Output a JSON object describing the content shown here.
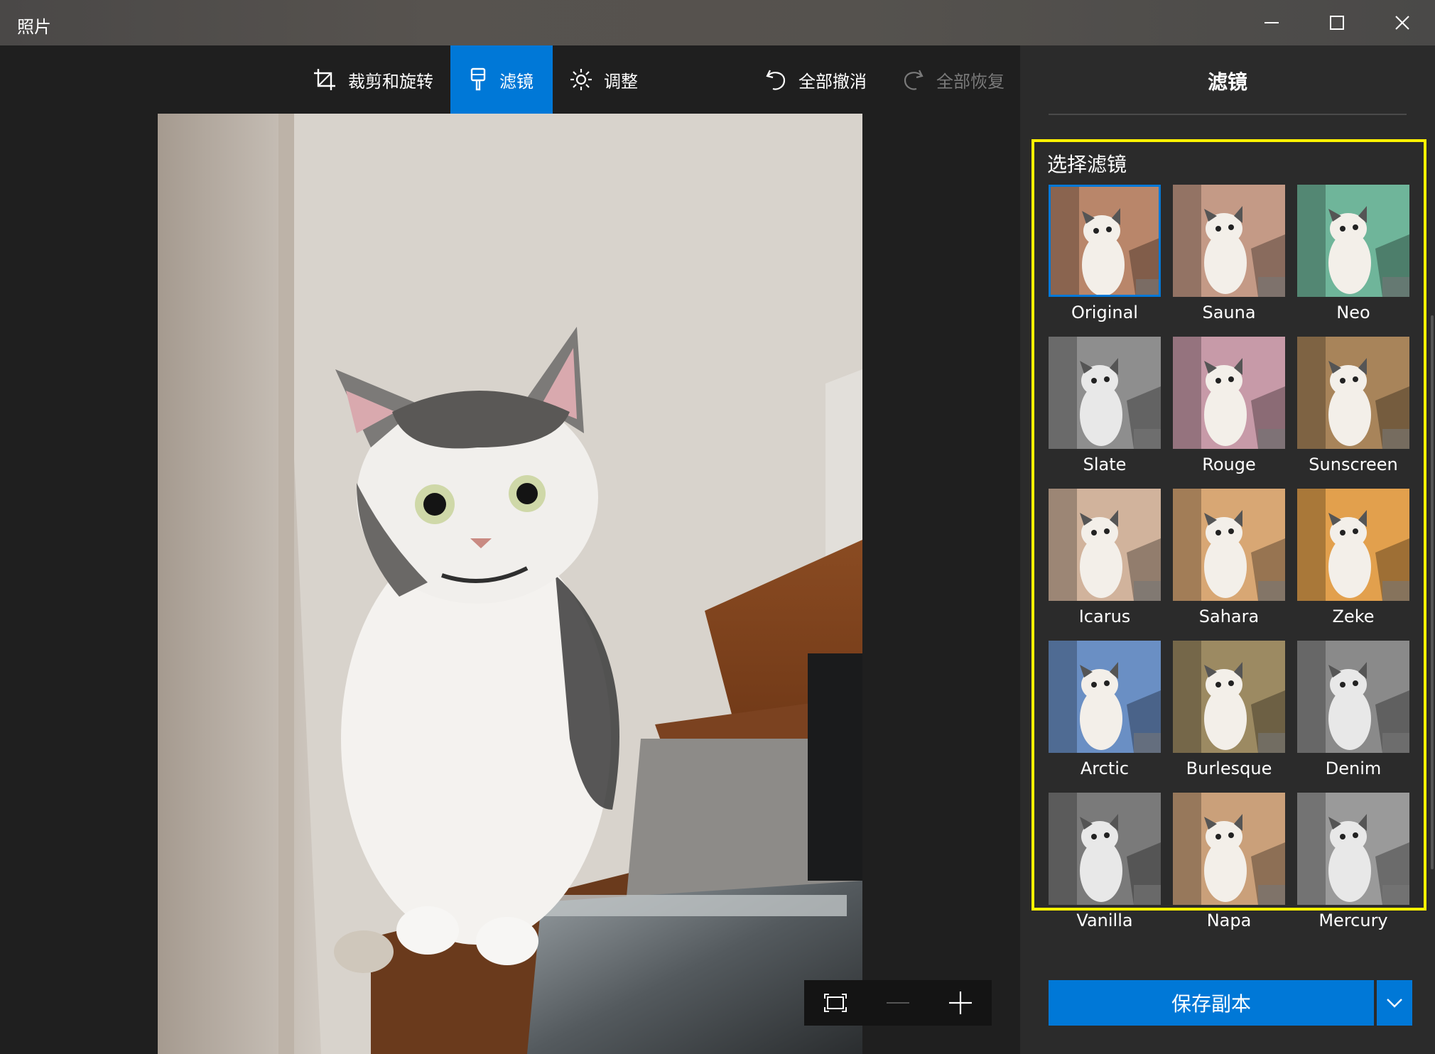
{
  "window": {
    "title": "照片",
    "controls": [
      "minimize-icon",
      "maximize-icon",
      "close-icon"
    ]
  },
  "toolbar": {
    "crop_label": "裁剪和旋转",
    "filter_label": "滤镜",
    "adjust_label": "调整",
    "undo_all_label": "全部撤消",
    "redo_all_label": "全部恢复",
    "active_tab": "滤镜"
  },
  "panel": {
    "title": "滤镜",
    "heading": "选择滤镜",
    "filters": [
      {
        "label": "Original",
        "selected": true
      },
      {
        "label": "Sauna"
      },
      {
        "label": "Neo"
      },
      {
        "label": "Slate"
      },
      {
        "label": "Rouge"
      },
      {
        "label": "Sunscreen"
      },
      {
        "label": "Icarus"
      },
      {
        "label": "Sahara"
      },
      {
        "label": "Zeke"
      },
      {
        "label": "Arctic"
      },
      {
        "label": "Burlesque"
      },
      {
        "label": "Denim"
      },
      {
        "label": "Vanilla"
      },
      {
        "label": "Napa"
      },
      {
        "label": "Mercury"
      }
    ],
    "save_label": "保存副本"
  },
  "colors": {
    "accent": "#0078d7",
    "highlight_border": "#fff200",
    "panel_bg": "#2b2b2b",
    "app_bg": "#1f1f1f"
  }
}
